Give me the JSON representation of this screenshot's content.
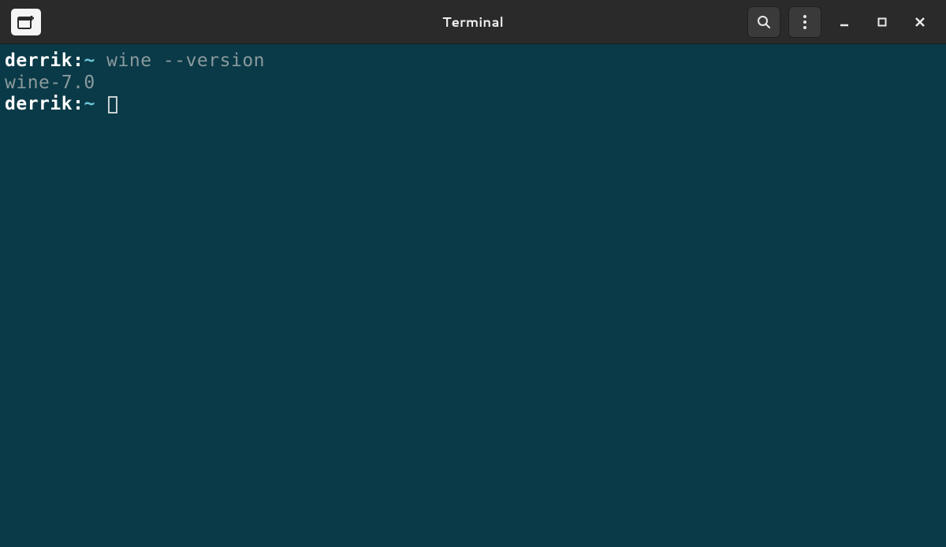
{
  "titlebar": {
    "title": "Terminal"
  },
  "terminal": {
    "lines": [
      {
        "user": "derrik",
        "sep": ":",
        "path": "~",
        "command": " wine --version"
      },
      {
        "output": "wine-7.0"
      },
      {
        "user": "derrik",
        "sep": ":",
        "path": "~",
        "command": " "
      }
    ]
  }
}
